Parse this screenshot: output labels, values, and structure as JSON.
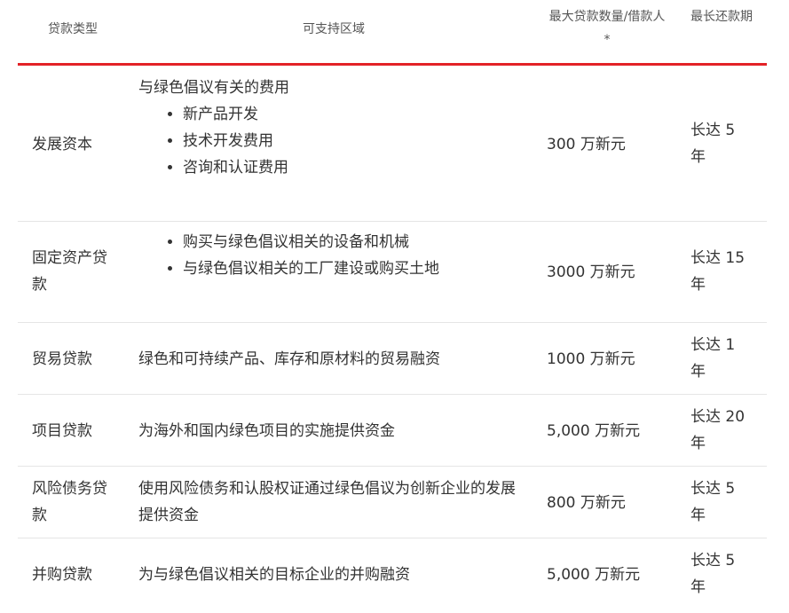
{
  "header": {
    "col1": "贷款类型",
    "col2": "可支持区域",
    "col3": "最大贷款数量/借款人*",
    "col4": "最长还款期"
  },
  "rows": [
    {
      "type": "发展资本",
      "area_intro": "与绿色倡议有关的费用",
      "area_items": [
        "新产品开发",
        "技术开发费用",
        "咨询和认证费用"
      ],
      "amount": "300 万新元",
      "term": "长达 5 年"
    },
    {
      "type": "固定资产贷款",
      "area_items": [
        "购买与绿色倡议相关的设备和机械",
        "与绿色倡议相关的工厂建设或购买土地"
      ],
      "amount": "3000 万新元",
      "term": "长达 15 年"
    },
    {
      "type": "贸易贷款",
      "area": "绿色和可持续产品、库存和原材料的贸易融资",
      "amount": "1000 万新元",
      "term": "长达 1 年"
    },
    {
      "type": "项目贷款",
      "area": "为海外和国内绿色项目的实施提供资金",
      "amount": "5,000 万新元",
      "term": "长达 20 年"
    },
    {
      "type": "风险债务贷款",
      "area": "使用风险债务和认股权证通过绿色倡议为创新企业的发展提供资金",
      "amount": "800 万新元",
      "term": "长达 5 年"
    },
    {
      "type": "并购贷款",
      "area": "为与绿色倡议相关的目标企业的并购融资",
      "amount": "5,000 万新元",
      "term": "长达 5 年"
    }
  ],
  "colors": {
    "accent": "#e32227",
    "divider": "#e5e5e5"
  }
}
